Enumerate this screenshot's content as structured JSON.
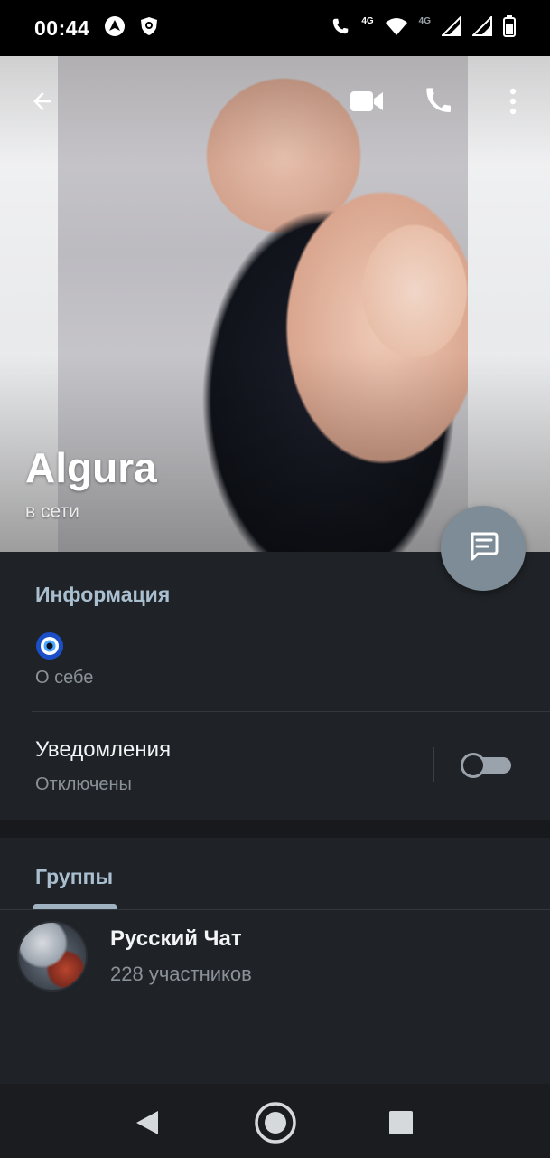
{
  "status_bar": {
    "time": "00:44",
    "network_badge_1": "4G",
    "network_badge_2": "4G",
    "icons": [
      "navigation-icon",
      "shield-lion-icon",
      "volte-call-icon",
      "wifi-icon",
      "signal-icon",
      "signal-icon",
      "battery-icon"
    ]
  },
  "profile": {
    "name": "Algura",
    "status": "в сети"
  },
  "topbar": {
    "icons": [
      "back-arrow-icon",
      "video-camera-icon",
      "phone-icon",
      "more-vertical-icon"
    ]
  },
  "info": {
    "title": "Информация",
    "about_emoji": "🧿",
    "about_label": "О себе",
    "notifications_title": "Уведомления",
    "notifications_value": "Отключены",
    "notifications_enabled": false
  },
  "groups": {
    "title": "Группы",
    "items": [
      {
        "name": "Русский Чат",
        "members": "228 участников"
      }
    ]
  },
  "colors": {
    "background": "#1f2226",
    "accent": "#a9bfd0",
    "fab": "#7e8c98",
    "muted_text": "#8a9299"
  },
  "navbar": {
    "icons": [
      "back-triangle-icon",
      "home-circle-icon",
      "recents-square-icon"
    ]
  }
}
